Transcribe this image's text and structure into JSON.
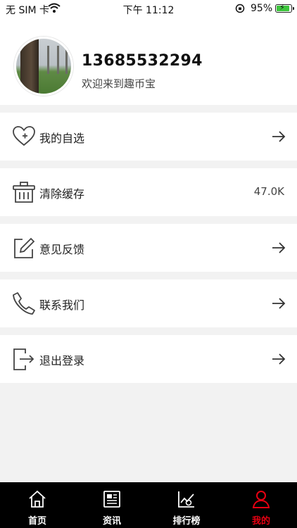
{
  "status_bar": {
    "carrier": "无 SIM 卡",
    "time": "下午 11:12",
    "battery": "95%"
  },
  "profile": {
    "phone": "13685532294",
    "welcome": "欢迎来到趣币宝"
  },
  "menu": {
    "favorites": {
      "label": "我的自选",
      "icon": "heart-plus-icon"
    },
    "clear_cache": {
      "label": "清除缓存",
      "value": "47.0K",
      "icon": "trash-basket-icon"
    },
    "feedback": {
      "label": "意见反馈",
      "icon": "edit-note-icon"
    },
    "contact": {
      "label": "联系我们",
      "icon": "phone-icon"
    },
    "logout": {
      "label": "退出登录",
      "icon": "logout-icon"
    }
  },
  "tabs": [
    {
      "label": "首页",
      "icon": "home-icon"
    },
    {
      "label": "资讯",
      "icon": "news-icon"
    },
    {
      "label": "排行榜",
      "icon": "ranking-chart-icon"
    },
    {
      "label": "我的",
      "icon": "user-icon",
      "active": true
    }
  ],
  "colors": {
    "accent": "#e60012",
    "tab_bar_bg": "#000000",
    "page_bg": "#f2f2f2"
  }
}
